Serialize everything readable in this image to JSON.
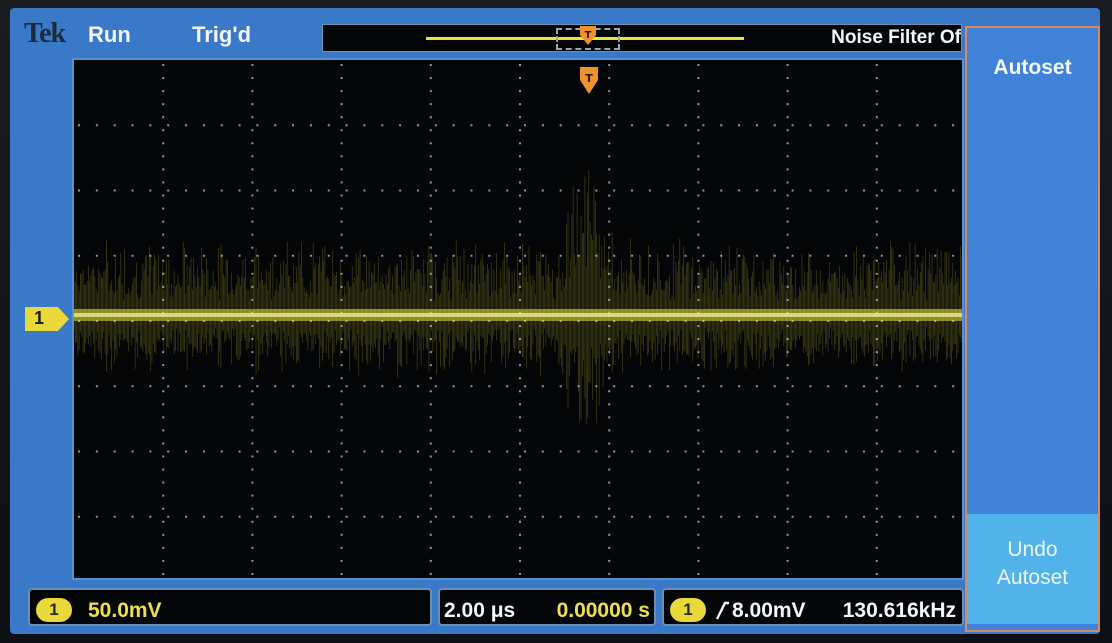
{
  "header": {
    "brand": "Tek",
    "acq_state": "Run",
    "trigger_state": "Trig'd",
    "filter_label": "Noise Filter Of"
  },
  "channel": {
    "number": "1",
    "scale": "50.0mV"
  },
  "horizontal": {
    "time_per_div": "2.00 μs",
    "position": "0.00000 s"
  },
  "trigger": {
    "source": "1",
    "slope_icon": "rising-edge-icon",
    "level": "8.00mV",
    "frequency": "130.616kHz"
  },
  "softkeys": {
    "autoset": "Autoset",
    "undo_line1": "Undo",
    "undo_line2": "Autoset"
  },
  "colors": {
    "trace": "#e8e23a",
    "panel": "#3f82d8",
    "undo_key": "#52b2ea",
    "screen_bg": "#3a78c8",
    "trigger_marker": "#f0932c"
  },
  "graticule": {
    "h_divs": 10,
    "v_divs": 8
  }
}
